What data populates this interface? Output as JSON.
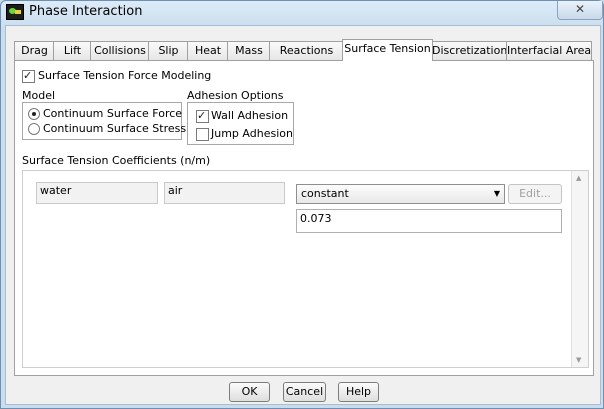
{
  "window": {
    "title": "Phase Interaction",
    "close_symbol": "✕"
  },
  "tabs": [
    {
      "label": "Drag",
      "active": false
    },
    {
      "label": "Lift",
      "active": false
    },
    {
      "label": "Collisions",
      "active": false
    },
    {
      "label": "Slip",
      "active": false
    },
    {
      "label": "Heat",
      "active": false
    },
    {
      "label": "Mass",
      "active": false
    },
    {
      "label": "Reactions",
      "active": false
    },
    {
      "label": "Surface Tension",
      "active": true
    },
    {
      "label": "Discretization",
      "active": false
    },
    {
      "label": "Interfacial Area",
      "active": false
    }
  ],
  "surface_tension_force_modeling": {
    "label": "Surface Tension Force Modeling",
    "checked": true
  },
  "model": {
    "heading": "Model",
    "options": [
      {
        "label": "Continuum Surface Force",
        "selected": true
      },
      {
        "label": "Continuum Surface Stress",
        "selected": false
      }
    ]
  },
  "adhesion": {
    "heading": "Adhesion Options",
    "options": [
      {
        "label": "Wall Adhesion",
        "checked": true
      },
      {
        "label": "Jump Adhesion",
        "checked": false
      }
    ]
  },
  "coefficients": {
    "heading": "Surface Tension Coefficients (n/m)",
    "phase1": "water",
    "phase2": "air",
    "method": "constant",
    "edit_label": "Edit...",
    "value": "0.073"
  },
  "footer": {
    "ok_label": "OK",
    "cancel_label": "Cancel",
    "help_label": "Help"
  }
}
